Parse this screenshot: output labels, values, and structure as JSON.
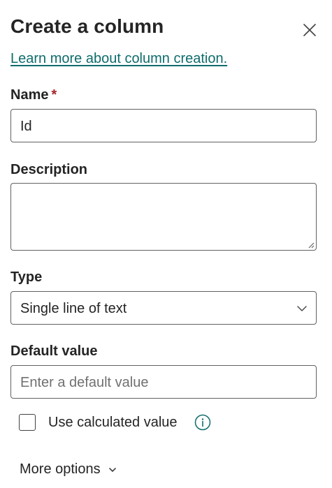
{
  "panel": {
    "title": "Create a column",
    "close_icon": "close-icon",
    "learn_link": "Learn more about column creation."
  },
  "name": {
    "label": "Name",
    "required_marker": "*",
    "value": "Id"
  },
  "description": {
    "label": "Description",
    "value": ""
  },
  "type": {
    "label": "Type",
    "selected": "Single line of text",
    "icon": "chevron-down-icon"
  },
  "default_value": {
    "label": "Default value",
    "placeholder": "Enter a default value",
    "value": ""
  },
  "calculated": {
    "label": "Use calculated value",
    "checked": false,
    "info_icon": "info-icon"
  },
  "more_options": {
    "label": "More options",
    "icon": "chevron-down-icon"
  },
  "colors": {
    "link": "#0f6c6c",
    "required": "#a4262c",
    "text": "#242424",
    "border": "#616161"
  }
}
